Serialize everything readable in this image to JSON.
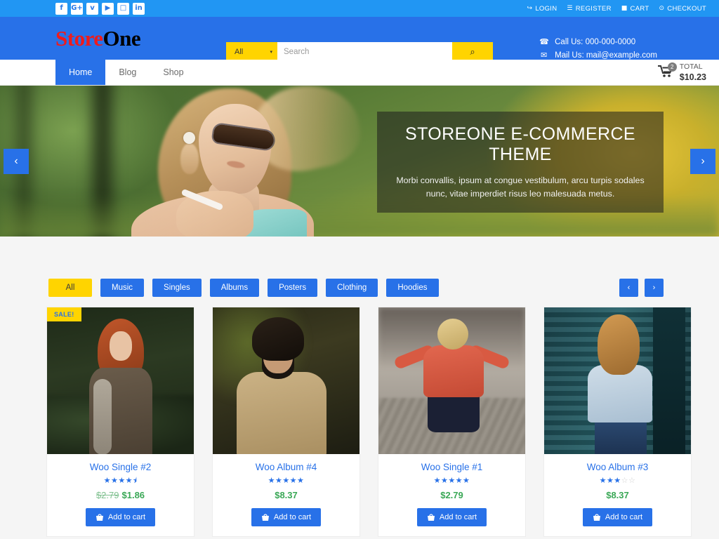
{
  "topbar": {
    "social": [
      {
        "name": "facebook-icon",
        "glyph": "f"
      },
      {
        "name": "google-plus-icon",
        "glyph": "G+"
      },
      {
        "name": "twitter-icon",
        "glyph": "ᴠ"
      },
      {
        "name": "youtube-icon",
        "glyph": "▶"
      },
      {
        "name": "instagram-icon",
        "glyph": "□"
      },
      {
        "name": "linkedin-icon",
        "glyph": "in"
      }
    ],
    "links": [
      {
        "label": "LOGIN",
        "icon": "↪"
      },
      {
        "label": "REGISTER",
        "icon": "☰"
      },
      {
        "label": "CART",
        "icon": "■"
      },
      {
        "label": "CHECKOUT",
        "icon": "⊙"
      }
    ]
  },
  "header": {
    "logo_first": "Store",
    "logo_second": "One",
    "search": {
      "category": "All",
      "caret": "▾",
      "placeholder": "Search",
      "value": "",
      "button_icon": "⌕"
    },
    "contact": {
      "phone_icon": "☎",
      "phone": "Call Us: 000-000-0000",
      "mail_icon": "✉",
      "mail": "Mail Us: mail@example.com"
    }
  },
  "nav": {
    "items": [
      {
        "label": "Home",
        "active": true
      },
      {
        "label": "Blog",
        "active": false
      },
      {
        "label": "Shop",
        "active": false
      }
    ],
    "cart": {
      "icon": "Ὥ2",
      "badge": "2",
      "label": "TOTAL",
      "total": "$10.23"
    }
  },
  "hero": {
    "title": "STOREONE E-COMMERCE THEME",
    "subtitle": "Morbi convallis, ipsum at congue vestibulum, arcu turpis sodales nunc, vitae imperdiet risus leo malesuada metus.",
    "prev_icon": "‹",
    "next_icon": "›"
  },
  "filters": {
    "items": [
      {
        "label": "All",
        "active": true
      },
      {
        "label": "Music",
        "active": false
      },
      {
        "label": "Singles",
        "active": false
      },
      {
        "label": "Albums",
        "active": false
      },
      {
        "label": "Posters",
        "active": false
      },
      {
        "label": "Clothing",
        "active": false
      },
      {
        "label": "Hoodies",
        "active": false
      }
    ],
    "prev_icon": "‹",
    "next_icon": "›"
  },
  "products": [
    {
      "title": "Woo Single #2",
      "badge": "SALE!",
      "rating": 4.5,
      "old_price": "$2.79",
      "price": "$1.86",
      "button": "Add to cart",
      "button_icon": "Ὤd"
    },
    {
      "title": "Woo Album #4",
      "badge": "",
      "rating": 5,
      "old_price": "",
      "price": "$8.37",
      "button": "Add to cart",
      "button_icon": "Ὤd"
    },
    {
      "title": "Woo Single #1",
      "badge": "",
      "rating": 5,
      "old_price": "",
      "price": "$2.79",
      "button": "Add to cart",
      "button_icon": "Ὤd"
    },
    {
      "title": "Woo Album #3",
      "badge": "",
      "rating": 3,
      "old_price": "",
      "price": "$8.37",
      "button": "Add to cart",
      "button_icon": "Ὤd"
    }
  ],
  "colors": {
    "topbar_blue": "#2196f3",
    "header_blue": "#2871e8",
    "accent_yellow": "#ffd400",
    "price_green": "#3aa856",
    "logo_red": "#ef1b1b"
  }
}
